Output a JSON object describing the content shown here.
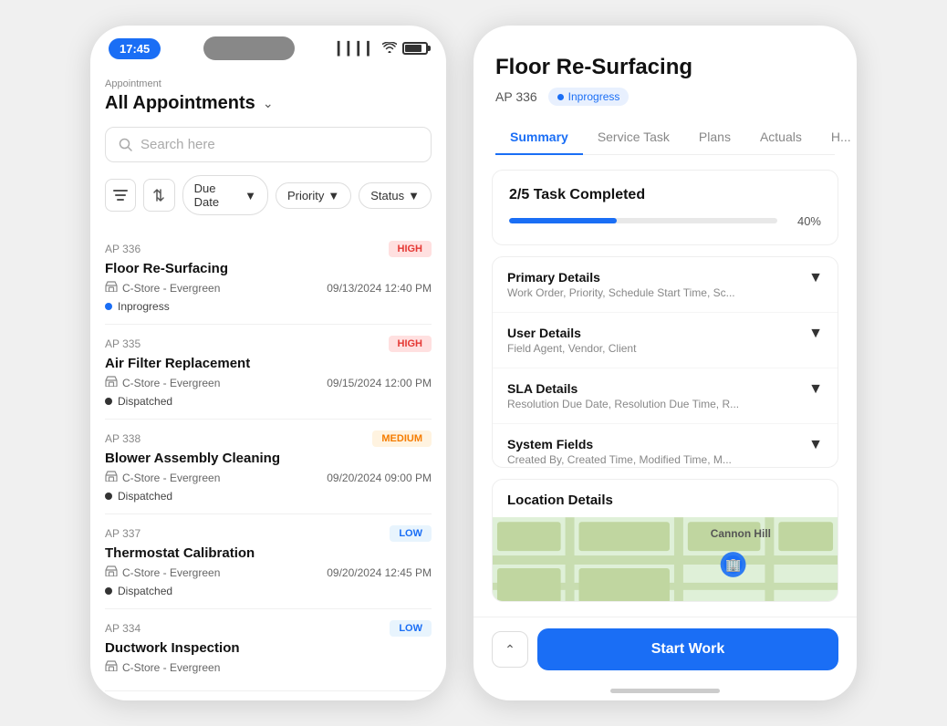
{
  "left_phone": {
    "status_bar": {
      "time": "17:45",
      "signal": "▎▎▎",
      "wifi": "WiFi",
      "battery": "Battery"
    },
    "appointment_label": "Appointment",
    "appointment_title": "All Appointments",
    "search_placeholder": "Search here",
    "filters": {
      "filter_icon": "filter",
      "sort_icon": "sort",
      "due_date": "Due Date",
      "priority": "Priority",
      "status": "Status"
    },
    "appointments": [
      {
        "id": "AP 336",
        "name": "Floor Re-Surfacing",
        "store": "C-Store - Evergreen",
        "date": "09/13/2024 12:40 PM",
        "status": "Inprogress",
        "status_dot": "blue",
        "priority": "HIGH",
        "priority_type": "high"
      },
      {
        "id": "AP 335",
        "name": "Air Filter Replacement",
        "store": "C-Store - Evergreen",
        "date": "09/15/2024 12:00 PM",
        "status": "Dispatched",
        "status_dot": "dark",
        "priority": "HIGH",
        "priority_type": "high"
      },
      {
        "id": "AP 338",
        "name": "Blower Assembly Cleaning",
        "store": "C-Store - Evergreen",
        "date": "09/20/2024 09:00 PM",
        "status": "Dispatched",
        "status_dot": "dark",
        "priority": "MEDIUM",
        "priority_type": "medium"
      },
      {
        "id": "AP 337",
        "name": "Thermostat Calibration",
        "store": "C-Store - Evergreen",
        "date": "09/20/2024 12:45 PM",
        "status": "Dispatched",
        "status_dot": "dark",
        "priority": "LOW",
        "priority_type": "low"
      },
      {
        "id": "AP 334",
        "name": "Ductwork Inspection",
        "store": "C-Store - Evergreen",
        "date": "",
        "status": "",
        "status_dot": "blue",
        "priority": "LOW",
        "priority_type": "low"
      }
    ]
  },
  "right_panel": {
    "title": "Floor Re-Surfacing",
    "ap_number": "AP 336",
    "status_badge": "Inprogress",
    "tabs": [
      "Summary",
      "Service Task",
      "Plans",
      "Actuals",
      "H..."
    ],
    "active_tab": "Summary",
    "task_completed": {
      "label": "2/5 Task Completed",
      "progress_pct": 40,
      "progress_label": "40%"
    },
    "details": [
      {
        "title": "Primary Details",
        "sub": "Work Order, Priority, Schedule Start Time, Sc..."
      },
      {
        "title": "User Details",
        "sub": "Field Agent, Vendor, Client"
      },
      {
        "title": "SLA Details",
        "sub": "Resolution Due Date, Resolution Due Time, R..."
      },
      {
        "title": "System Fields",
        "sub": "Created By, Created Time, Modified Time, M..."
      }
    ],
    "location": {
      "title": "Location Details",
      "map_label": "Cannon Hill"
    },
    "start_work_button": "Start Work",
    "collapse_icon": "chevron-up"
  }
}
